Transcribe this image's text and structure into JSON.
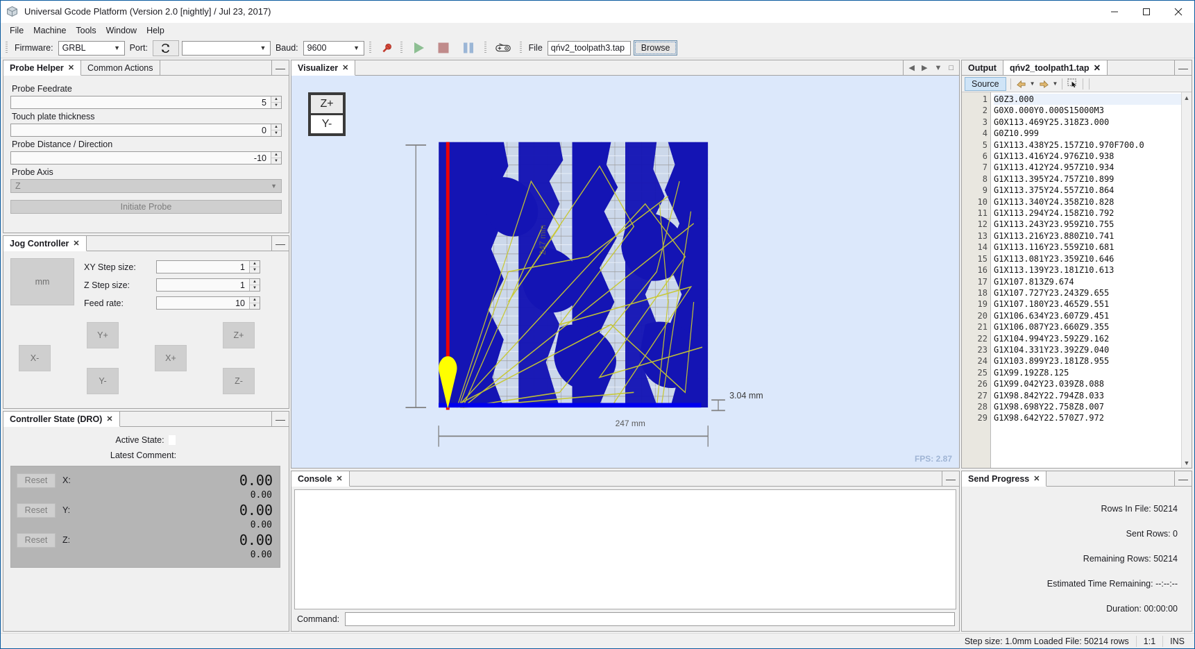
{
  "window": {
    "title": "Universal Gcode Platform (Version 2.0 [nightly]  / Jul 23, 2017)",
    "app_icon": "cube-icon",
    "minimize_label": "—",
    "maximize_label": "□",
    "close_label": "✕"
  },
  "menubar": {
    "items": [
      {
        "label": "File"
      },
      {
        "label": "Machine"
      },
      {
        "label": "Tools"
      },
      {
        "label": "Window"
      },
      {
        "label": "Help"
      }
    ]
  },
  "toolbar": {
    "firmware_label": "Firmware:",
    "firmware_value": "GRBL",
    "port_label": "Port:",
    "refresh_icon": "refresh-icon",
    "port_value": "",
    "baud_label": "Baud:",
    "baud_value": "9600",
    "connect_icon": "plug-icon",
    "play_icon": "play-icon",
    "stop_icon": "stop-icon",
    "pause_icon": "pause-icon",
    "macro_icon": "gamepad-icon",
    "file_label": "File",
    "file_value": "qńv2_toolpath3.tap",
    "browse_label": "Browse"
  },
  "probe_panel": {
    "tabs": [
      {
        "label": "Probe Helper",
        "closable": true,
        "active": true
      },
      {
        "label": "Common Actions",
        "closable": false,
        "active": false
      }
    ],
    "minimize_label": "—",
    "fields": [
      {
        "label": "Probe Feedrate",
        "value": "5"
      },
      {
        "label": "Touch plate thickness",
        "value": "0"
      },
      {
        "label": "Probe Distance / Direction",
        "value": "-10"
      }
    ],
    "axis_label": "Probe Axis",
    "axis_value": "Z",
    "initiate_label": "Initiate Probe"
  },
  "jog_panel": {
    "tab_label": "Jog Controller",
    "minimize_label": "—",
    "unit_label": "mm",
    "rows": [
      {
        "label": "XY Step size:",
        "value": "1"
      },
      {
        "label": "Z Step size:",
        "value": "1"
      },
      {
        "label": "Feed rate:",
        "value": "10"
      }
    ],
    "buttons": {
      "y_plus": "Y+",
      "y_minus": "Y-",
      "x_plus": "X+",
      "x_minus": "X-",
      "z_plus": "Z+",
      "z_minus": "Z-"
    }
  },
  "dro_panel": {
    "tab_label": "Controller State (DRO)",
    "minimize_label": "—",
    "active_state_label": "Active State:",
    "active_state_value": "",
    "latest_comment_label": "Latest Comment:",
    "latest_comment_value": "",
    "reset_label": "Reset",
    "axes": [
      {
        "name": "X:",
        "work": "0.00",
        "machine": "0.00"
      },
      {
        "name": "Y:",
        "work": "0.00",
        "machine": "0.00"
      },
      {
        "name": "Z:",
        "work": "0.00",
        "machine": "0.00"
      }
    ]
  },
  "visualizer": {
    "tab_label": "Visualizer",
    "minimize_label": "—",
    "maximize_label": "□",
    "prev_label": "◀",
    "next_label": "▶",
    "dropdown_label": "▼",
    "axis_top": "Z+",
    "axis_bottom": "Y-",
    "fps": "FPS: 2.87",
    "dim_height": "247 mm",
    "dim_width": "247 mm",
    "dim_z": "3.04 mm"
  },
  "console_panel": {
    "tab_label": "Console",
    "minimize_label": "—",
    "output_text": "",
    "command_label": "Command:",
    "command_value": ""
  },
  "output_panel": {
    "output_tab_label": "Output",
    "file_tab_label": "qńv2_toolpath1.tap",
    "minimize_label": "—",
    "source_label": "Source",
    "back_icon": "back-icon",
    "forward_icon": "forward-icon",
    "select-icon": "rect-select-icon",
    "scroll_up": "▲",
    "scroll_down": "▼",
    "lines": [
      {
        "n": "1",
        "text": "G0Z3.000"
      },
      {
        "n": "2",
        "text": "G0X0.000Y0.000S15000M3"
      },
      {
        "n": "3",
        "text": "G0X113.469Y25.318Z3.000"
      },
      {
        "n": "4",
        "text": "G0Z10.999"
      },
      {
        "n": "5",
        "text": "G1X113.438Y25.157Z10.970F700.0"
      },
      {
        "n": "6",
        "text": "G1X113.416Y24.976Z10.938"
      },
      {
        "n": "7",
        "text": "G1X113.412Y24.957Z10.934"
      },
      {
        "n": "8",
        "text": "G1X113.395Y24.757Z10.899"
      },
      {
        "n": "9",
        "text": "G1X113.375Y24.557Z10.864"
      },
      {
        "n": "10",
        "text": "G1X113.340Y24.358Z10.828"
      },
      {
        "n": "11",
        "text": "G1X113.294Y24.158Z10.792"
      },
      {
        "n": "12",
        "text": "G1X113.243Y23.959Z10.755"
      },
      {
        "n": "13",
        "text": "G1X113.216Y23.880Z10.741"
      },
      {
        "n": "14",
        "text": "G1X113.116Y23.559Z10.681"
      },
      {
        "n": "15",
        "text": "G1X113.081Y23.359Z10.646"
      },
      {
        "n": "16",
        "text": "G1X113.139Y23.181Z10.613"
      },
      {
        "n": "17",
        "text": "G1X107.813Z9.674"
      },
      {
        "n": "18",
        "text": "G1X107.727Y23.243Z9.655"
      },
      {
        "n": "19",
        "text": "G1X107.180Y23.465Z9.551"
      },
      {
        "n": "20",
        "text": "G1X106.634Y23.607Z9.451"
      },
      {
        "n": "21",
        "text": "G1X106.087Y23.660Z9.355"
      },
      {
        "n": "22",
        "text": "G1X104.994Y23.592Z9.162"
      },
      {
        "n": "23",
        "text": "G1X104.331Y23.392Z9.040"
      },
      {
        "n": "24",
        "text": "G1X103.899Y23.181Z8.955"
      },
      {
        "n": "25",
        "text": "G1X99.192Z8.125"
      },
      {
        "n": "26",
        "text": "G1X99.042Y23.039Z8.088"
      },
      {
        "n": "27",
        "text": "G1X98.842Y22.794Z8.033"
      },
      {
        "n": "28",
        "text": "G1X98.698Y22.758Z8.007"
      },
      {
        "n": "29",
        "text": "G1X98.642Y22.570Z7.972"
      }
    ]
  },
  "send_progress": {
    "tab_label": "Send Progress",
    "minimize_label": "—",
    "rows": [
      "Rows In File: 50214",
      "Sent Rows: 0",
      "Remaining Rows: 50214",
      "Estimated Time Remaining: --:--:--",
      "Duration: 00:00:00"
    ]
  },
  "statusbar": {
    "step_info": "Step size: 1.0mm Loaded File: 50214 rows",
    "caret": "1:1",
    "insert_mode": "INS"
  },
  "colors": {
    "accent": "#0a5a9e",
    "canvas_bg": "#dce8fb",
    "toolpath": "#c8c830",
    "model": "#1414b4",
    "x_axis": "#ee0000",
    "y_axis": "#0000ee",
    "tool": "#ffff00"
  }
}
